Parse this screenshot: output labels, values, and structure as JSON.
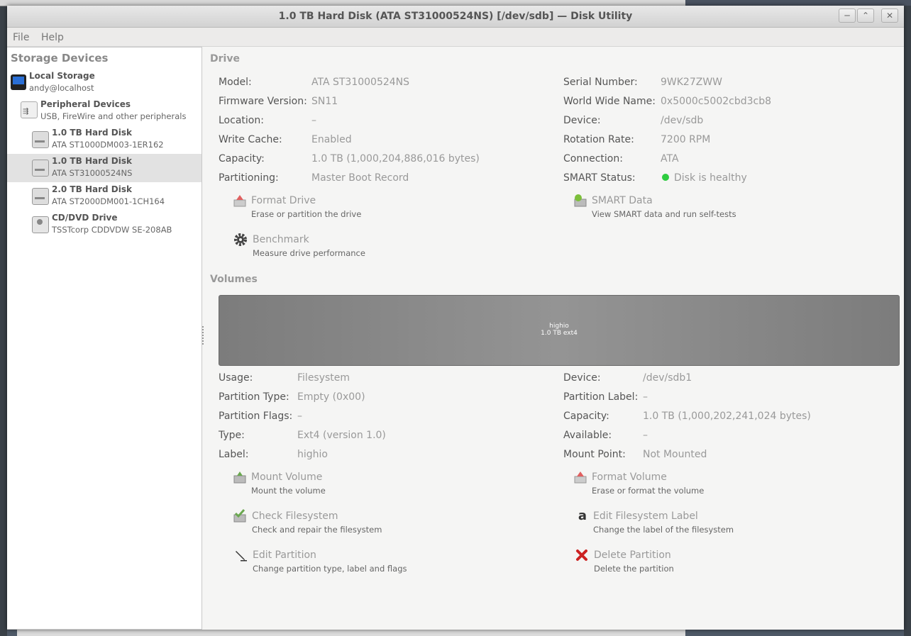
{
  "window": {
    "title": "1.0 TB Hard Disk (ATA ST31000524NS) [/dev/sdb] — Disk Utility",
    "minimize": "─",
    "maximize": "⌃",
    "close": "✕"
  },
  "menu": [
    "File",
    "Help"
  ],
  "sidebar": {
    "title": "Storage Devices",
    "items": [
      {
        "name": "Local Storage",
        "sub": "andy@localhost",
        "icon": "computer-icon"
      },
      {
        "name": "Peripheral Devices",
        "sub": "USB, FireWire and other peripherals",
        "icon": "usb-icon"
      },
      {
        "name": "1.0 TB Hard Disk",
        "sub": "ATA ST1000DM003-1ER162",
        "icon": "hard-disk-icon"
      },
      {
        "name": "1.0 TB Hard Disk",
        "sub": "ATA ST31000524NS",
        "icon": "hard-disk-icon",
        "selected": true
      },
      {
        "name": "2.0 TB Hard Disk",
        "sub": "ATA ST2000DM001-1CH164",
        "icon": "hard-disk-icon"
      },
      {
        "name": "CD/DVD Drive",
        "sub": "TSSTcorp CDDVDW SE-208AB",
        "icon": "optical-drive-icon"
      }
    ]
  },
  "drive": {
    "section_title": "Drive",
    "left": [
      {
        "label": "Model:",
        "value": "ATA ST31000524NS"
      },
      {
        "label": "Firmware Version:",
        "value": "SN11"
      },
      {
        "label": "Location:",
        "value": "–"
      },
      {
        "label": "Write Cache:",
        "value": "Enabled"
      },
      {
        "label": "Capacity:",
        "value": "1.0 TB (1,000,204,886,016 bytes)"
      },
      {
        "label": "Partitioning:",
        "value": "Master Boot Record"
      }
    ],
    "right": [
      {
        "label": "Serial Number:",
        "value": "9WK27ZWW"
      },
      {
        "label": "World Wide Name:",
        "value": "0x5000c5002cbd3cb8"
      },
      {
        "label": "Device:",
        "value": "/dev/sdb"
      },
      {
        "label": "Rotation Rate:",
        "value": "7200 RPM"
      },
      {
        "label": "Connection:",
        "value": "ATA"
      },
      {
        "label": "SMART Status:",
        "value": "Disk is healthy"
      }
    ],
    "actions": {
      "format_title": "Format Drive",
      "format_desc": "Erase or partition the drive",
      "smart_title": "SMART Data",
      "smart_desc": "View SMART data and run self-tests",
      "bench_title": "Benchmark",
      "bench_desc": "Measure drive performance"
    }
  },
  "volumes": {
    "section_title": "Volumes",
    "bar": {
      "name": "highio",
      "size": "1.0 TB ext4"
    },
    "left": [
      {
        "label": "Usage:",
        "value": "Filesystem"
      },
      {
        "label": "Partition Type:",
        "value": "Empty (0x00)"
      },
      {
        "label": "Partition Flags:",
        "value": "–"
      },
      {
        "label": "Type:",
        "value": "Ext4 (version 1.0)"
      },
      {
        "label": "Label:",
        "value": "highio"
      }
    ],
    "right": [
      {
        "label": "Device:",
        "value": "/dev/sdb1"
      },
      {
        "label": "Partition Label:",
        "value": "–"
      },
      {
        "label": "Capacity:",
        "value": "1.0 TB (1,000,202,241,024 bytes)"
      },
      {
        "label": "Available:",
        "value": "–"
      },
      {
        "label": "Mount Point:",
        "value": "Not Mounted"
      }
    ],
    "actions": {
      "mount_title": "Mount Volume",
      "mount_desc": "Mount the volume",
      "formatvol_title": "Format Volume",
      "formatvol_desc": "Erase or format the volume",
      "check_title": "Check Filesystem",
      "check_desc": "Check and repair the filesystem",
      "editlabel_title": "Edit Filesystem Label",
      "editlabel_desc": "Change the label of the filesystem",
      "editpart_title": "Edit Partition",
      "editpart_desc": "Change partition type, label and flags",
      "delete_title": "Delete Partition",
      "delete_desc": "Delete the partition"
    }
  },
  "colors": {
    "healthy": "#2ecc40",
    "delete": "#cc2222"
  }
}
